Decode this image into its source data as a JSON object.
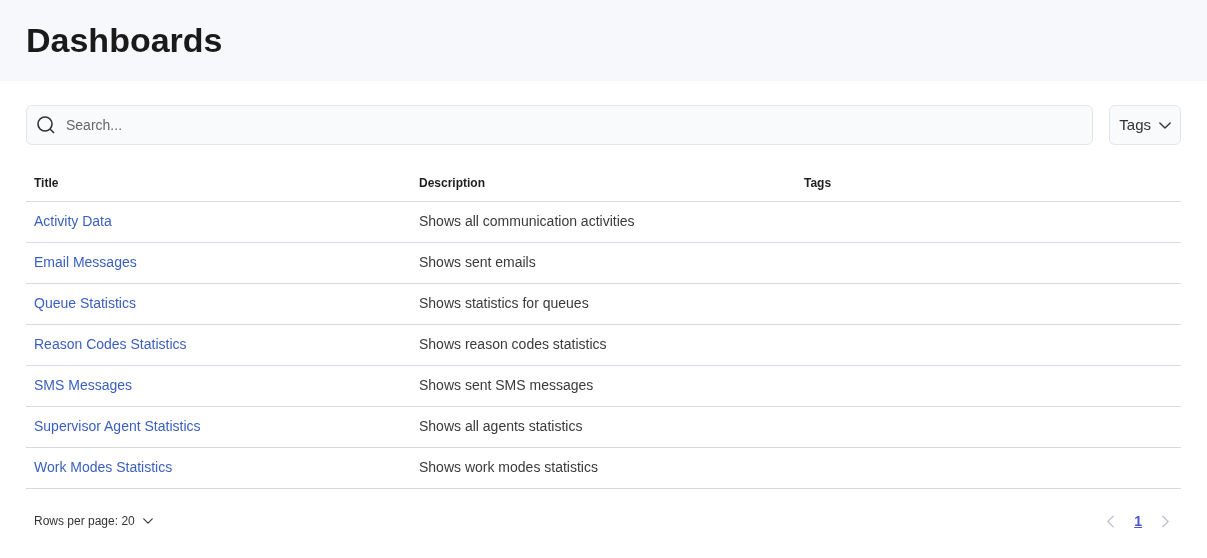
{
  "header": {
    "title": "Dashboards"
  },
  "search": {
    "placeholder": "Search..."
  },
  "tags_filter": {
    "label": "Tags"
  },
  "table": {
    "columns": [
      "Title",
      "Description",
      "Tags"
    ],
    "rows": [
      {
        "title": "Activity Data",
        "description": "Shows all communication activities"
      },
      {
        "title": "Email Messages",
        "description": "Shows sent emails"
      },
      {
        "title": "Queue Statistics",
        "description": "Shows statistics for queues"
      },
      {
        "title": "Reason Codes Statistics",
        "description": "Shows reason codes statistics"
      },
      {
        "title": "SMS Messages",
        "description": "Shows sent SMS messages"
      },
      {
        "title": "Supervisor Agent Statistics",
        "description": "Shows all agents statistics"
      },
      {
        "title": "Work Modes Statistics",
        "description": "Shows work modes statistics"
      }
    ]
  },
  "footer": {
    "rows_per_page": "Rows per page: 20",
    "pagination": {
      "prev_disabled": true,
      "next_disabled": true,
      "pages": [
        {
          "label": "1",
          "selected": true
        }
      ]
    }
  }
}
